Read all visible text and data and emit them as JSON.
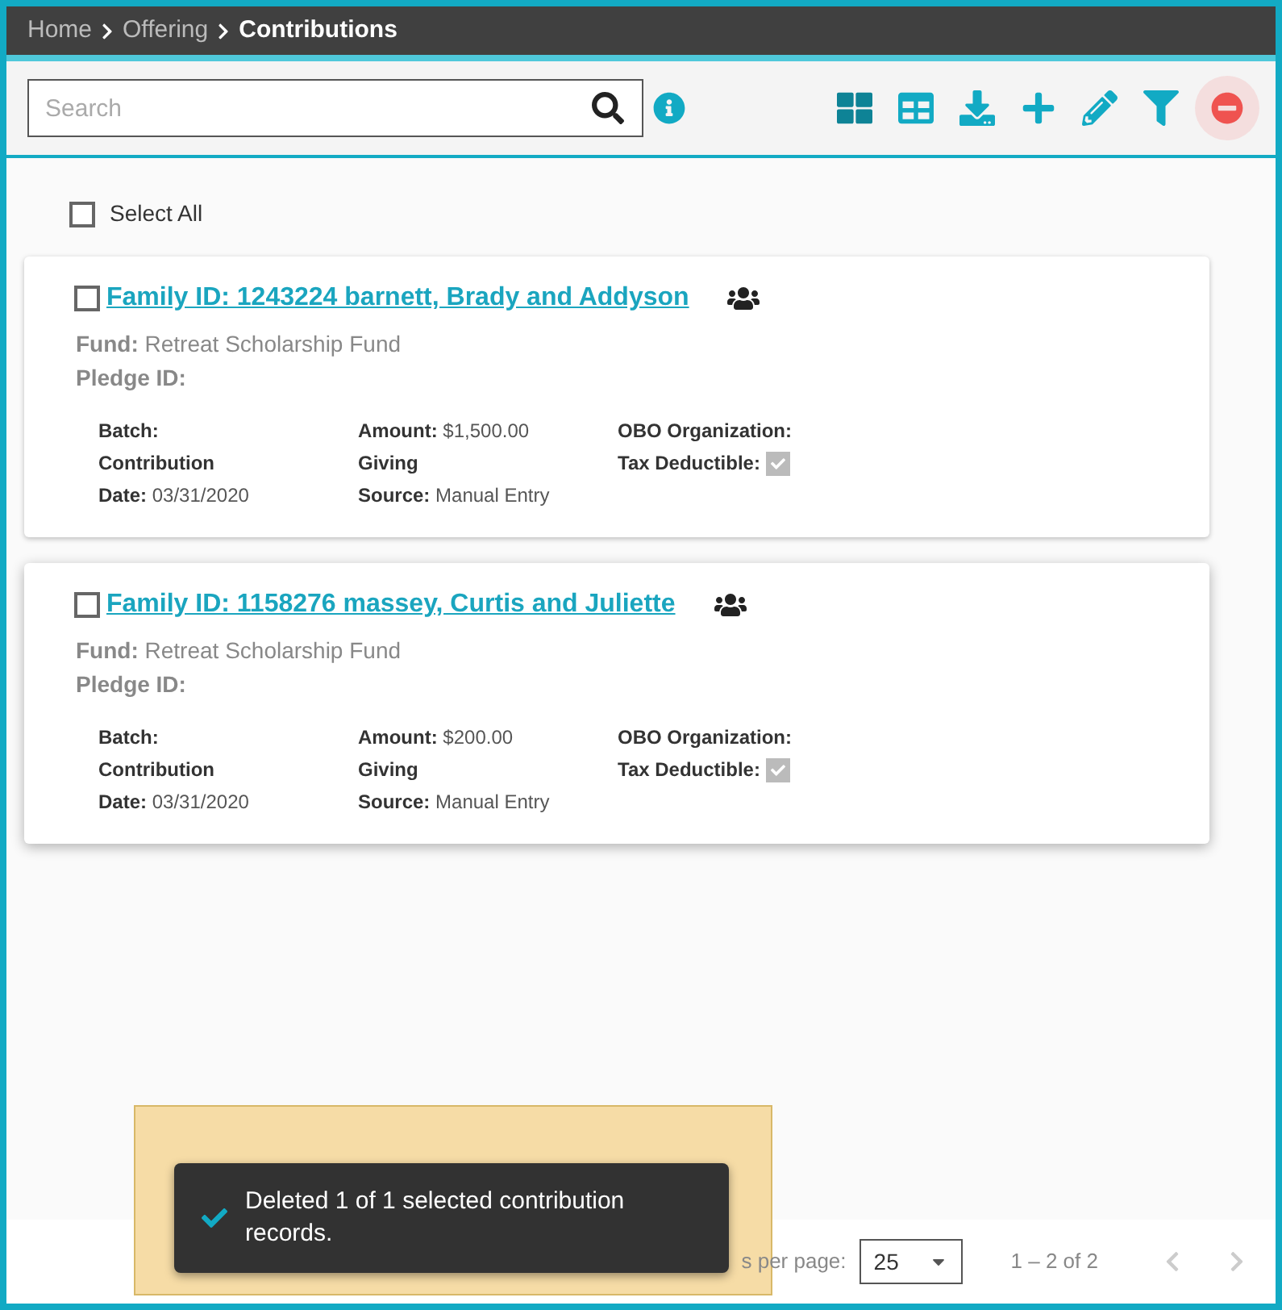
{
  "breadcrumb": [
    {
      "label": "Home",
      "current": false
    },
    {
      "label": "Offering",
      "current": false
    },
    {
      "label": "Contributions",
      "current": true
    }
  ],
  "search": {
    "placeholder": "Search"
  },
  "select_all": {
    "label": "Select All",
    "checked": false
  },
  "records": [
    {
      "title": "Family ID: 1243224 barnett, Brady and Addyson",
      "checked": false,
      "fund_label": "Fund:",
      "fund": "Retreat Scholarship Fund",
      "pledge_label": "Pledge ID:",
      "batch_label": "Batch:",
      "type": "Contribution",
      "date_label": "Date:",
      "date": "03/31/2020",
      "amount_label": "Amount:",
      "amount": "$1,500.00",
      "category": "Giving",
      "source_label": "Source:",
      "source": "Manual Entry",
      "obo_label": "OBO Organization:",
      "tax_label": "Tax Deductible:",
      "tax_deductible": true
    },
    {
      "title": "Family ID: 1158276 massey, Curtis and Juliette",
      "checked": false,
      "fund_label": "Fund:",
      "fund": "Retreat Scholarship Fund",
      "pledge_label": "Pledge ID:",
      "batch_label": "Batch:",
      "type": "Contribution",
      "date_label": "Date:",
      "date": "03/31/2020",
      "amount_label": "Amount:",
      "amount": "$200.00",
      "category": "Giving",
      "source_label": "Source:",
      "source": "Manual Entry",
      "obo_label": "OBO Organization:",
      "tax_label": "Tax Deductible:",
      "tax_deductible": true
    }
  ],
  "pagination": {
    "per_page_label": "s per page:",
    "per_page": "25",
    "range": "1 – 2 of 2"
  },
  "toast": {
    "message": "Deleted 1 of 1 selected contribution records."
  }
}
